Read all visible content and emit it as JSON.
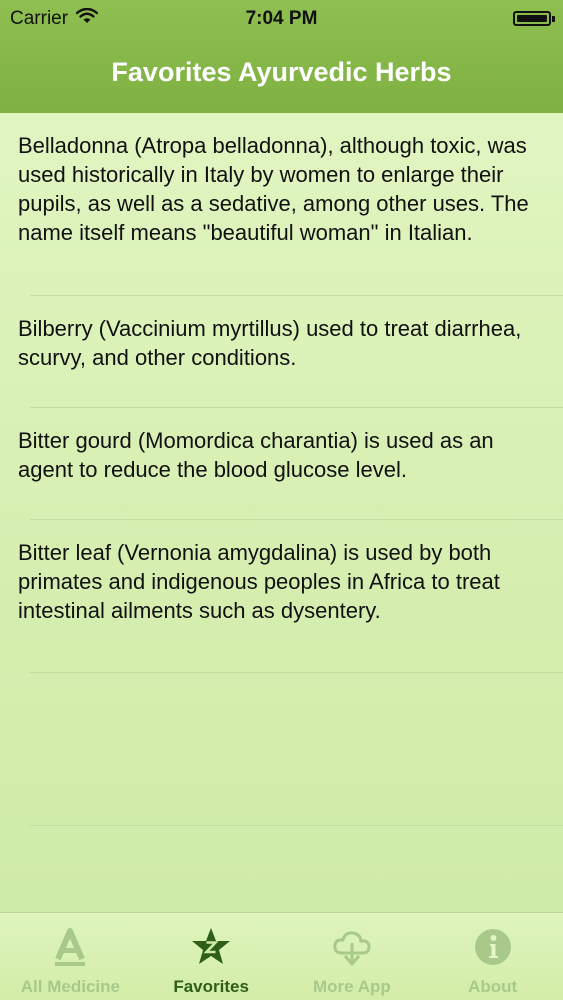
{
  "status_bar": {
    "carrier": "Carrier",
    "time": "7:04 PM"
  },
  "header": {
    "title": "Favorites Ayurvedic Herbs"
  },
  "favorites": [
    {
      "text": "Belladonna (Atropa belladonna), although toxic, was used historically in Italy by women to enlarge their pupils, as well as a sedative, among other uses. The name itself means \"beautiful woman\" in Italian."
    },
    {
      "text": "Bilberry (Vaccinium myrtillus) used to treat diarrhea, scurvy, and other conditions."
    },
    {
      "text": "Bitter gourd (Momordica charantia) is used as an agent to reduce the blood glucose level."
    },
    {
      "text": "Bitter leaf (Vernonia amygdalina) is used by both primates and indigenous peoples in Africa to treat intestinal ailments such as dysentery."
    }
  ],
  "tab_bar": {
    "tabs": [
      {
        "label": "All Medicine",
        "icon": "letter-a-icon",
        "active": false
      },
      {
        "label": "Favorites",
        "icon": "star-icon",
        "active": true
      },
      {
        "label": "More App",
        "icon": "cloud-download-icon",
        "active": false
      },
      {
        "label": "About",
        "icon": "info-icon",
        "active": false
      }
    ]
  },
  "colors": {
    "header": "#86b84a",
    "background": "#d9f1b5",
    "active_tab": "#2e5e18",
    "inactive_tab": "#a9c98a"
  }
}
